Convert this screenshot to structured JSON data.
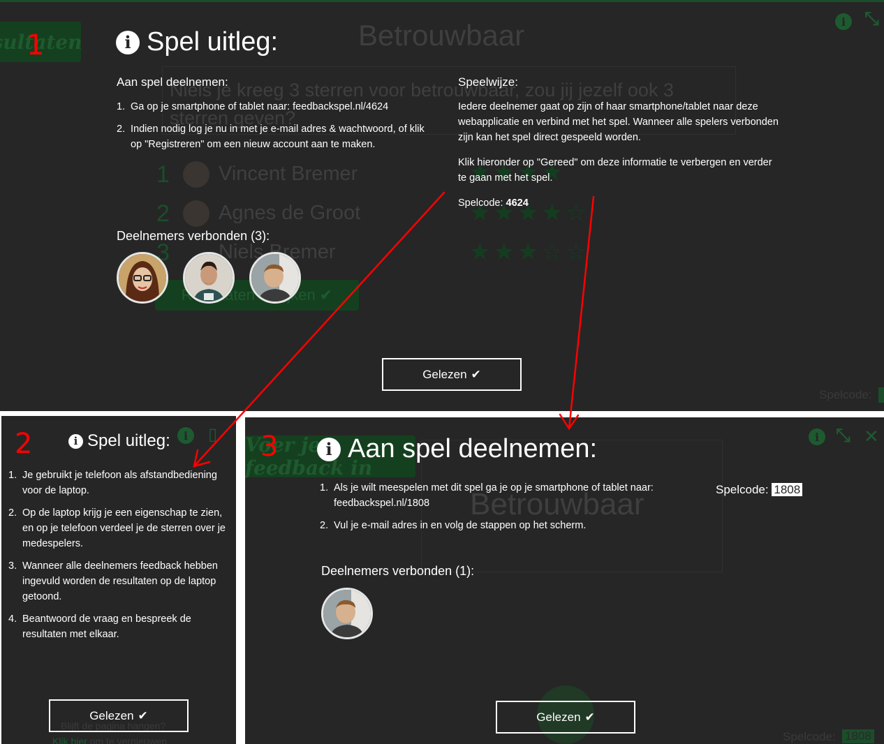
{
  "panel1": {
    "marker": "1",
    "heading": "Spel uitleg:",
    "join_title": "Aan spel deelnemen:",
    "join_steps": [
      "Ga op je smartphone of tablet naar: feedbackspel.nl/4624",
      "Indien nodig log je nu in met je e-mail adres & wachtwoord, of klik op \"Registreren\" om een nieuw account aan te maken."
    ],
    "mode_title": "Speelwijze:",
    "mode_paragraphs": [
      "Iedere deelnemer gaat op zijn of haar smartphone/tablet naar deze webapplicatie en verbind met het spel. Wanneer alle spelers verbonden zijn kan het spel direct gespeeld worden.",
      "Klik hieronder op \"Gereed\" om deze informatie te verbergen en verder te gaan met het spel."
    ],
    "code_label": "Spelcode:",
    "code_value": "4624",
    "connected_label": "Deelnemers verbonden (3):",
    "button_label": "Gelezen",
    "background": {
      "title": "Betrouwbaar",
      "question": "Niels je kreeg 3 sterren voor betrouwbaar, zou jij jezelf ook 3 sterren geven?",
      "results_button": "sultaten",
      "ranks": [
        "1",
        "2",
        "3"
      ],
      "names": [
        "Vincent Bremer",
        "Agnes de Groot",
        "Niels Bremer"
      ],
      "next_button": "Resultaten bekijken",
      "stars_full": "★★★★",
      "stars_row3": "★★★☆☆",
      "stars_row2": "★★★★☆",
      "code_label": "Spelcode:"
    }
  },
  "panel2": {
    "marker": "2",
    "heading": "Spel uitleg:",
    "steps": [
      "Je gebruikt je telefoon als afstandbediening voor de laptop.",
      "Op de laptop krijg je een eigenschap te zien, en op je telefoon verdeel je de sterren over je medespelers.",
      "Wanneer alle deelnemers feedback hebben ingevuld worden de resultaten op de laptop getoond.",
      "Beantwoord de vraag en bespreek de resultaten met elkaar."
    ],
    "button_label": "Gelezen",
    "background": {
      "hang_text": "Blijft de pagina hangen?",
      "refresh_link": "Klik hier",
      "refresh_rest": " om te vernieuwen"
    }
  },
  "panel3": {
    "marker": "3",
    "heading": "Aan spel deelnemen:",
    "steps": [
      "Als je wilt meespelen met dit spel ga je op je smartphone of tablet naar: feedbackspel.nl/1808",
      "Vul je e-mail adres in en volg de stappen op het scherm."
    ],
    "code_label": "Spelcode:",
    "code_value": "1808",
    "connected_label": "Deelnemers verbonden (1):",
    "button_label": "Gelezen",
    "background": {
      "title": "Betrouwbaar",
      "button": "Voer je feedback in",
      "code_label": "Spelcode:",
      "code_value": "1808"
    }
  },
  "colors": {
    "overlay_bg": "#262626",
    "brand_green": "#1b4d2b",
    "annotation_red": "#ff0000"
  },
  "icons": [
    "info-icon",
    "check-icon",
    "expand-icon",
    "close-icon"
  ]
}
